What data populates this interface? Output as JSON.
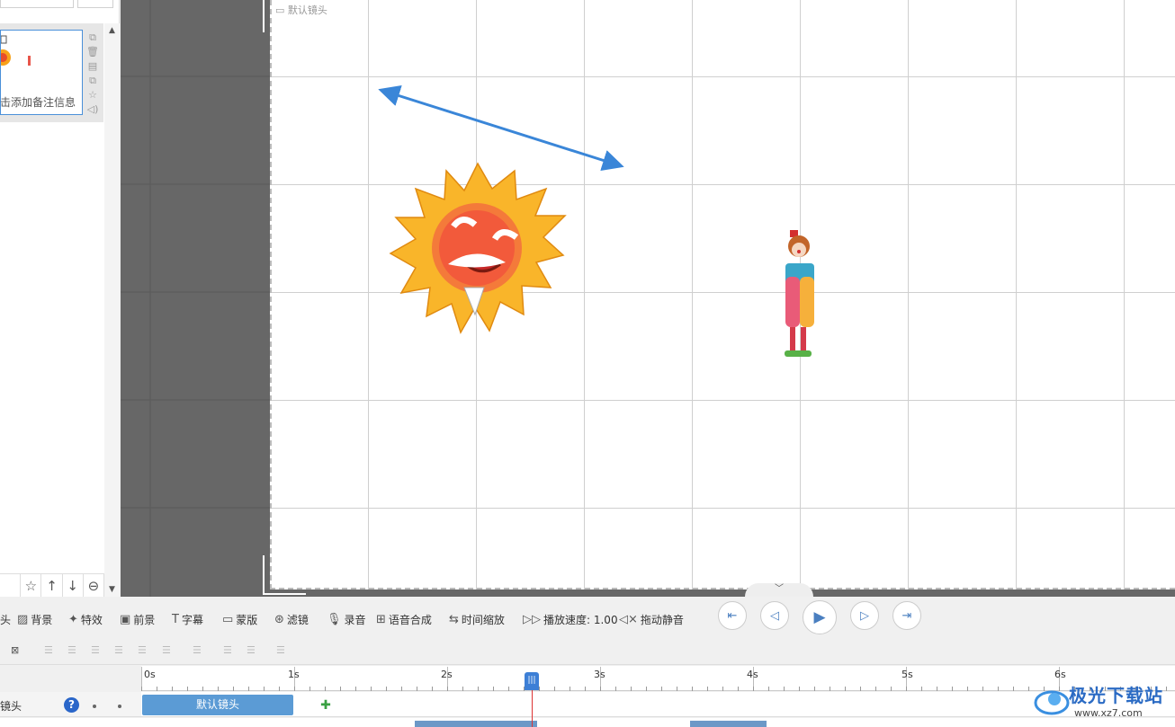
{
  "left_panel": {
    "thumb_note": "击添加备注信息",
    "thumb_tools": [
      "⧉",
      "🗑",
      "▤",
      "⧉",
      "☆",
      "◁)"
    ],
    "bottom_icons": [
      "☆",
      "↑",
      "↓",
      "⊖"
    ]
  },
  "stage": {
    "camera_label": "默认镜头"
  },
  "toolbar": {
    "items": [
      {
        "icon": "头",
        "label": ""
      },
      {
        "icon": "▨",
        "label": "背景"
      },
      {
        "icon": "✦",
        "label": "特效"
      },
      {
        "icon": "▣",
        "label": "前景"
      },
      {
        "icon": "T",
        "label": "字幕"
      },
      {
        "icon": "▭",
        "label": "蒙版"
      },
      {
        "icon": "⊛",
        "label": "滤镜"
      },
      {
        "icon": "🎙",
        "label": "录音"
      },
      {
        "icon": "⊞",
        "label": "语音合成"
      },
      {
        "icon": "⇆",
        "label": "时间缩放"
      },
      {
        "icon": "▷▷",
        "label": "播放速度: 1.00"
      },
      {
        "icon": "◁×",
        "label": "拖动静音"
      }
    ]
  },
  "playback": {
    "buttons": [
      "prev-scene",
      "prev-frame",
      "play",
      "next-frame",
      "next-scene"
    ]
  },
  "timeline": {
    "ticks": [
      "0s",
      "1s",
      "2s",
      "3s",
      "4s",
      "5s",
      "6s"
    ],
    "track_label": "镜头",
    "clip_label": "默认镜头",
    "playhead_icon": "|||",
    "playhead_time_seconds": 2.55
  },
  "watermark": {
    "title": "极光下载站",
    "url": "www.xz7.com"
  }
}
